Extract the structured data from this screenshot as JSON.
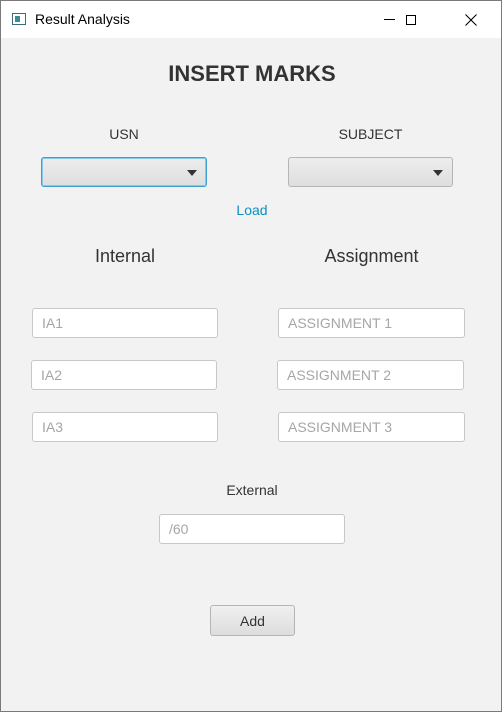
{
  "window": {
    "title": "Result Analysis"
  },
  "heading": "INSERT MARKS",
  "usn": {
    "label": "USN",
    "value": ""
  },
  "subject": {
    "label": "SUBJECT",
    "value": ""
  },
  "load_link": "Load",
  "internal": {
    "label": "Internal",
    "fields": [
      {
        "placeholder": "IA1",
        "value": ""
      },
      {
        "placeholder": "IA2",
        "value": ""
      },
      {
        "placeholder": "IA3",
        "value": ""
      }
    ]
  },
  "assignment": {
    "label": "Assignment",
    "fields": [
      {
        "placeholder": "ASSIGNMENT 1",
        "value": ""
      },
      {
        "placeholder": "ASSIGNMENT 2",
        "value": ""
      },
      {
        "placeholder": "ASSIGNMENT 3",
        "value": ""
      }
    ]
  },
  "external": {
    "label": "External",
    "placeholder": "/60",
    "value": ""
  },
  "add_button": "Add",
  "icons": {
    "app": "app-window-icon",
    "minimize": "minimize-icon",
    "maximize": "maximize-icon",
    "close": "close-icon",
    "dropdown": "chevron-down-icon"
  },
  "colors": {
    "link": "#0a8fc0",
    "focus": "#3b9fd4",
    "background": "#f2f2f2"
  }
}
